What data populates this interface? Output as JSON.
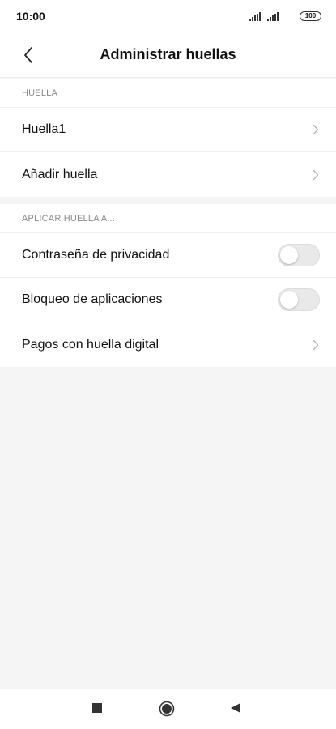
{
  "status_bar": {
    "time": "10:00",
    "battery": "100",
    "icons": [
      "signal-icon",
      "signal-icon",
      "battery-icon"
    ]
  },
  "header": {
    "title": "Administrar huellas",
    "back_icon": "chevron-left-icon"
  },
  "sections": [
    {
      "header": "HUELLA",
      "items": [
        {
          "label": "Huella1",
          "control": "chevron"
        },
        {
          "label": "Añadir huella",
          "control": "chevron"
        }
      ]
    },
    {
      "header": "APLICAR HUELLA A...",
      "items": [
        {
          "label": "Contraseña de privacidad",
          "control": "toggle",
          "on": false
        },
        {
          "label": "Bloqueo de aplicaciones",
          "control": "toggle",
          "on": false
        },
        {
          "label": "Pagos con huella digital",
          "control": "chevron"
        }
      ]
    }
  ],
  "nav_bar": {
    "icons": [
      "recents-square-icon",
      "home-circle-icon",
      "back-triangle-icon"
    ]
  },
  "colors": {
    "background": "#f5f5f5",
    "surface": "#ffffff",
    "text": "#111111",
    "section_header": "#8a8a8a",
    "toggle_off": "#e9e9e9"
  }
}
